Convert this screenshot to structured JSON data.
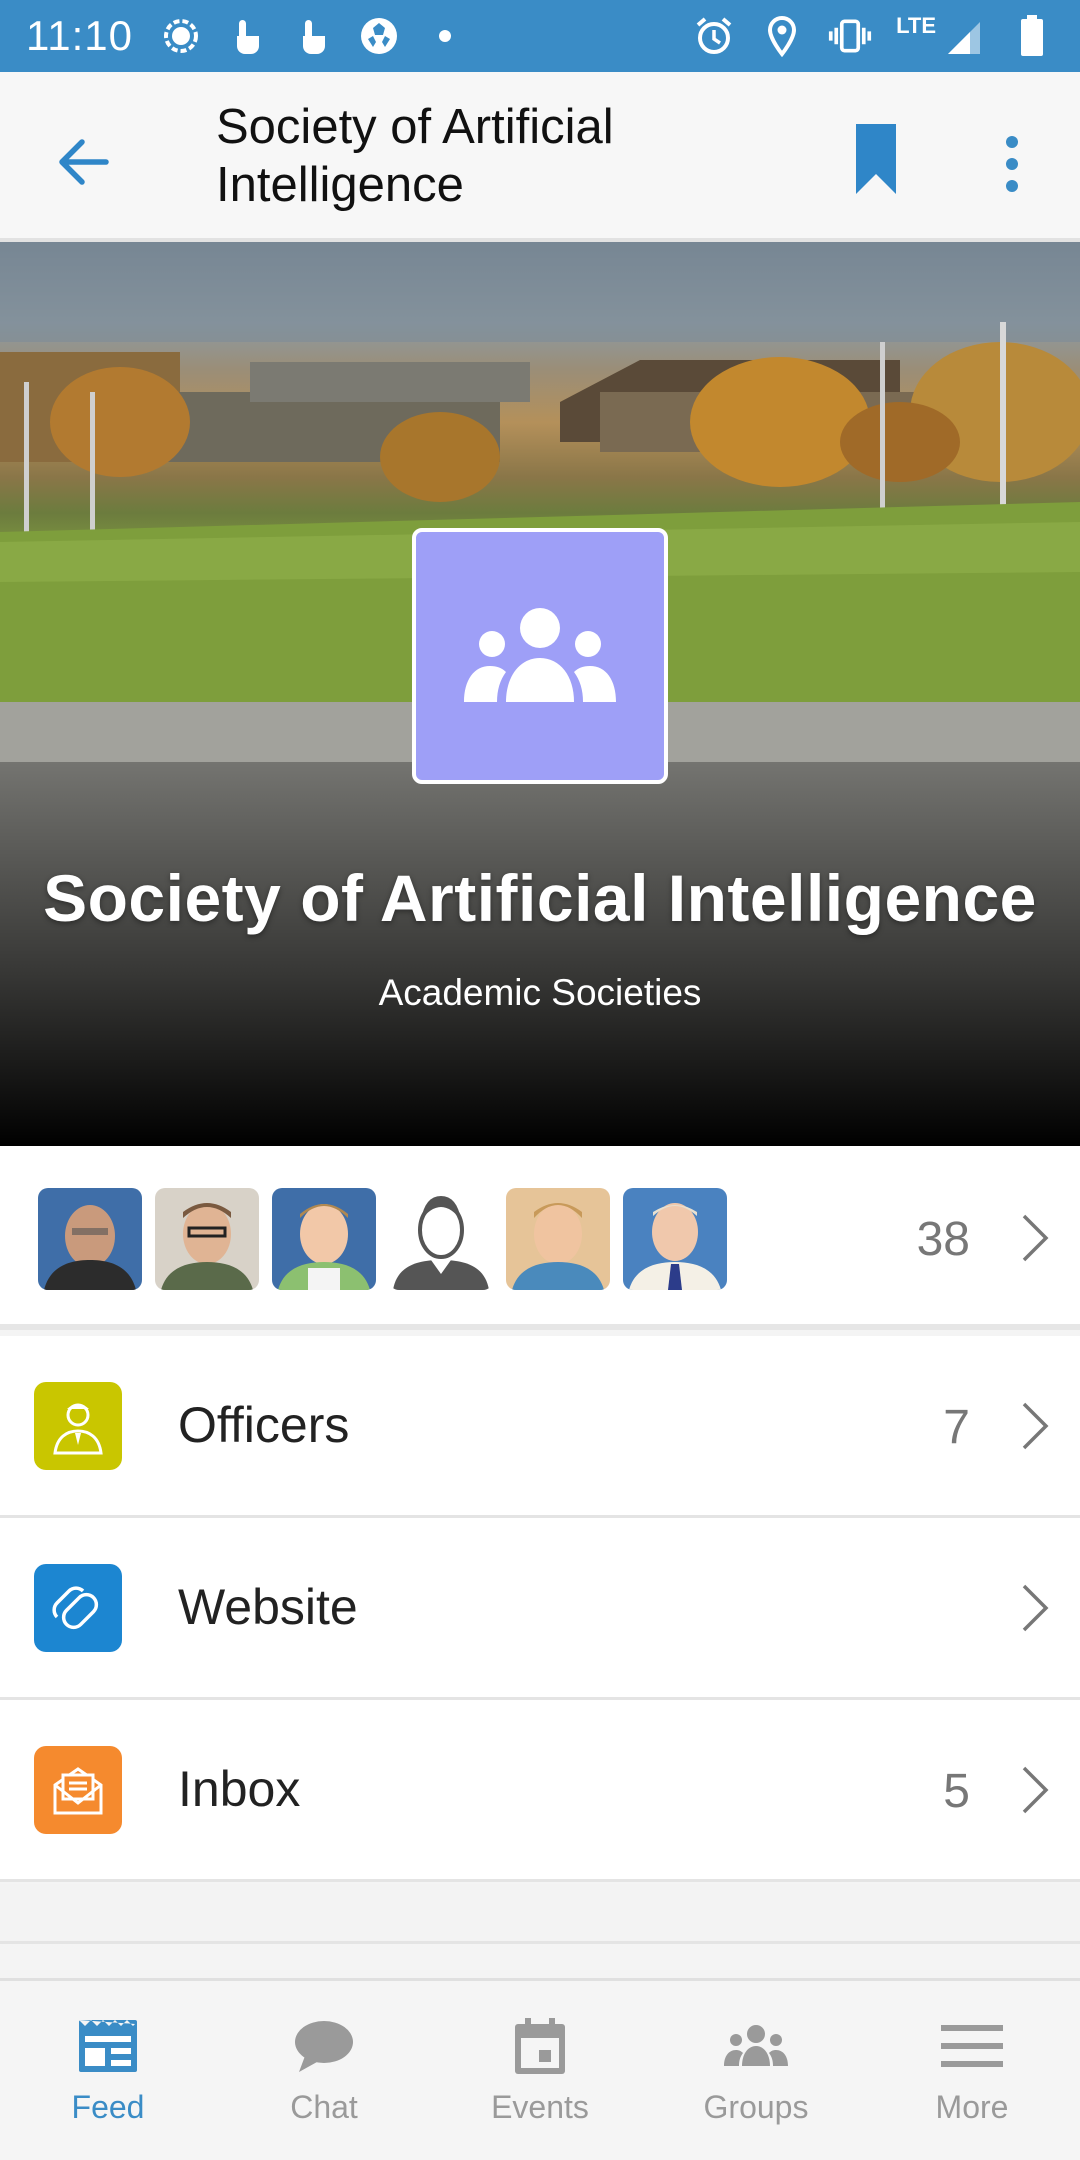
{
  "status_bar": {
    "time": "11:10",
    "network": "LTE",
    "left_icons": [
      "signal-messenger-icon",
      "touch-icon",
      "touch-icon",
      "soccer-ball-icon",
      "dot-icon"
    ],
    "right_icons": [
      "alarm-icon",
      "location-icon",
      "vibrate-icon",
      "cell-signal-icon",
      "battery-icon"
    ]
  },
  "app_bar": {
    "title": "Society of Artificial Intelligence",
    "back_icon": "arrow-back-icon",
    "bookmark_icon": "bookmark-icon",
    "more_icon": "more-vertical-icon"
  },
  "hero": {
    "title": "Society of Artificial Intelligence",
    "category": "Academic Societies",
    "logo_icon": "group-icon"
  },
  "members": {
    "count": "38",
    "avatars": [
      "member-1",
      "member-2",
      "member-3",
      "member-4",
      "member-5",
      "member-6"
    ]
  },
  "rows": [
    {
      "label": "Officers",
      "count": "7",
      "icon": "officer-icon",
      "color": "#c9c600"
    },
    {
      "label": "Website",
      "count": "",
      "icon": "link-icon",
      "color": "#1c86d1"
    },
    {
      "label": "Inbox",
      "count": "5",
      "icon": "envelope-icon",
      "color": "#f58a2e"
    }
  ],
  "bottom_nav": [
    {
      "label": "Feed",
      "icon": "feed-icon",
      "active": true
    },
    {
      "label": "Chat",
      "icon": "chat-icon",
      "active": false
    },
    {
      "label": "Events",
      "icon": "calendar-icon",
      "active": false
    },
    {
      "label": "Groups",
      "icon": "groups-icon",
      "active": false
    },
    {
      "label": "More",
      "icon": "menu-icon",
      "active": false
    }
  ],
  "colors": {
    "accent": "#3a8cc6",
    "logo_bg": "#9e9ff7"
  }
}
